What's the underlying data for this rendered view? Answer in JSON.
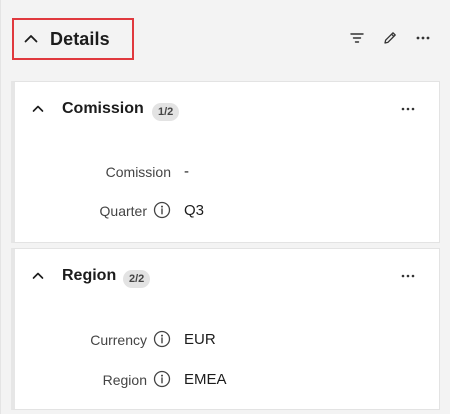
{
  "header": {
    "title": "Details",
    "icons": [
      "chevron-up-icon",
      "filter-icon",
      "edit-icon",
      "more-icon"
    ]
  },
  "sections": [
    {
      "title": "Comission",
      "badge": "1/2",
      "fields": [
        {
          "label": "Comission",
          "value": "-",
          "info": false
        },
        {
          "label": "Quarter",
          "value": "Q3",
          "info": true
        }
      ]
    },
    {
      "title": "Region",
      "badge": "2/2",
      "fields": [
        {
          "label": "Currency",
          "value": "EUR",
          "info": true
        },
        {
          "label": "Region",
          "value": "EMEA",
          "info": true
        }
      ]
    }
  ],
  "colors": {
    "highlight_border": "#e0393e",
    "panel_bg": "#f3f3f3",
    "card_bg": "#ffffff",
    "badge_bg": "#e3e3e3"
  }
}
